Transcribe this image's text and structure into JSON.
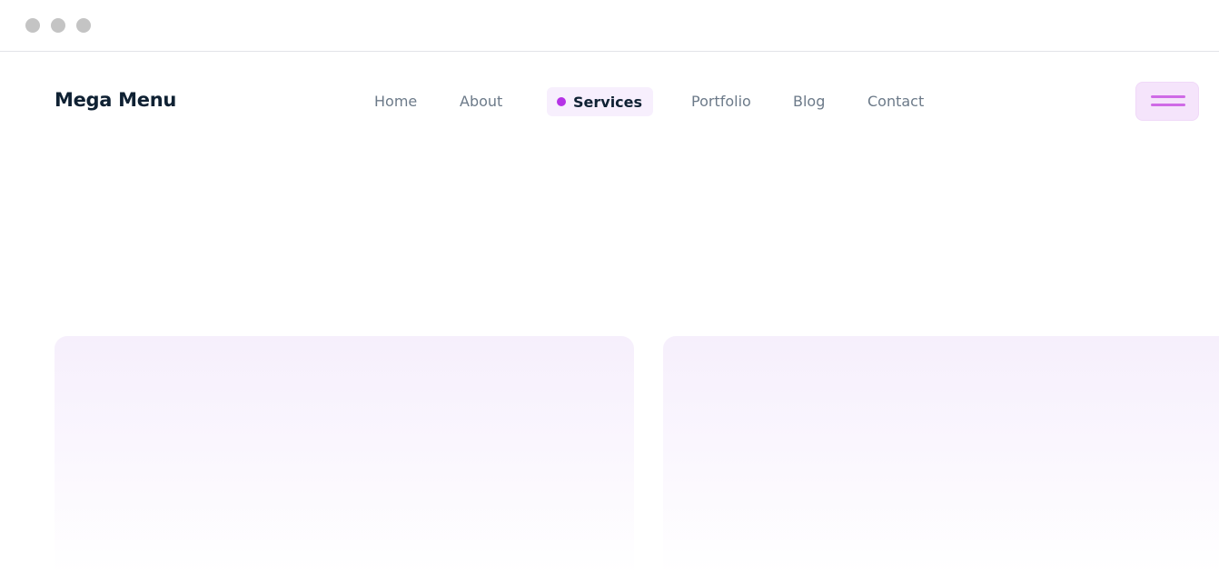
{
  "window": {
    "controls": [
      "window-dot",
      "window-dot",
      "window-dot"
    ]
  },
  "header": {
    "brand": "Mega Menu",
    "nav": {
      "items": [
        {
          "label": "Home"
        },
        {
          "label": "About"
        },
        {
          "label": "Services",
          "active": true
        },
        {
          "label": "Portfolio"
        },
        {
          "label": "Blog"
        },
        {
          "label": "Contact"
        }
      ]
    },
    "menu_button_icon": "hamburger-menu-icon"
  },
  "colors": {
    "brand_text": "#0f2133",
    "nav_text": "#6c7a89",
    "accent": "#b532e6",
    "accent_soft": "#f5e4fb",
    "card_tint": "#f6effc"
  }
}
